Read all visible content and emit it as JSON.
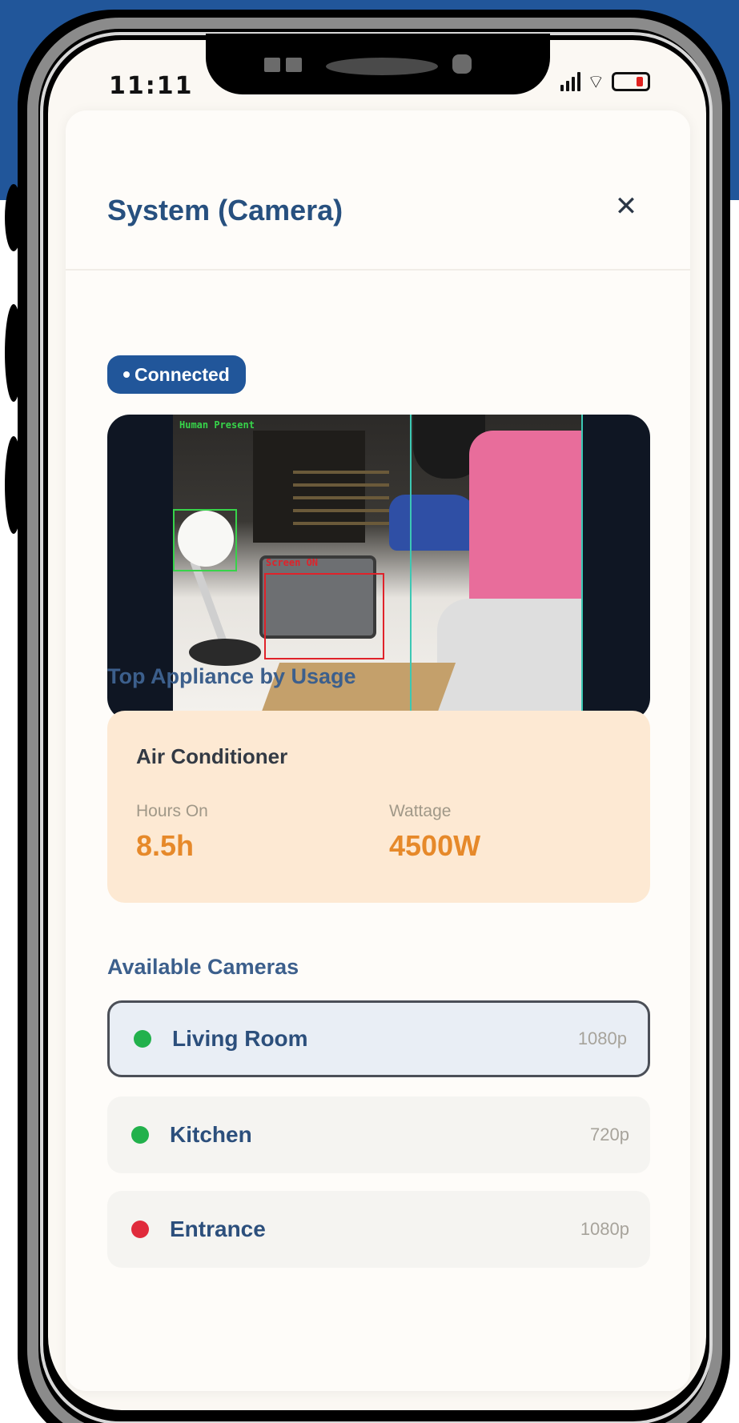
{
  "status_bar": {
    "time": "11:11",
    "icons": [
      "signal-icon",
      "wifi-icon",
      "battery-icon"
    ],
    "battery_color": "#e0221f"
  },
  "modal": {
    "title": "System (Camera)",
    "close_icon": "close-icon",
    "connection_badge": "Connected"
  },
  "camera_feed": {
    "detection_labels": [
      "Human Present",
      "Screen ON"
    ],
    "detection_colors": {
      "human": "#37d34a",
      "screen": "#e0222a",
      "guides": "#3cc8b4"
    }
  },
  "top_appliance": {
    "section_label": "Top Appliance by Usage",
    "name": "Air Conditioner",
    "hours_label": "Hours On",
    "hours_value": "8.5h",
    "wattage_label": "Wattage",
    "wattage_value": "4500W"
  },
  "cameras": {
    "section_label": "Available Cameras",
    "items": [
      {
        "name": "Living Room",
        "resolution": "1080p",
        "status_color": "#22b14c",
        "selected": true
      },
      {
        "name": "Kitchen",
        "resolution": "720p",
        "status_color": "#22b14c",
        "selected": false
      },
      {
        "name": "Entrance",
        "resolution": "1080p",
        "status_color": "#e02b3c",
        "selected": false
      }
    ]
  },
  "colors": {
    "brand_blue": "#21569a",
    "title_text": "#27507f",
    "accent_orange": "#e6892a",
    "appliance_bg": "#fde9d3"
  }
}
